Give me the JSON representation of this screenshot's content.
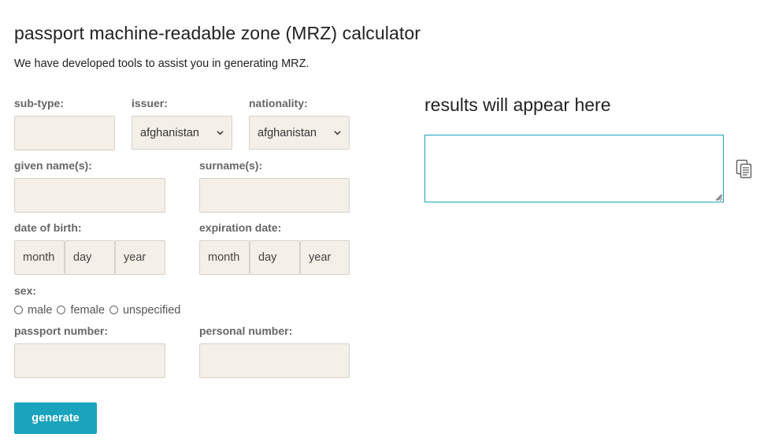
{
  "header": {
    "title": "passport machine-readable zone (MRZ) calculator",
    "subtitle": "We have developed tools to assist you in generating MRZ."
  },
  "form": {
    "subtype": {
      "label": "sub-type:",
      "value": ""
    },
    "issuer": {
      "label": "issuer:",
      "selected": "afghanistan"
    },
    "nationality": {
      "label": "nationality:",
      "selected": "afghanistan"
    },
    "given_names": {
      "label": "given name(s):",
      "value": ""
    },
    "surnames": {
      "label": "surname(s):",
      "value": ""
    },
    "dob": {
      "label": "date of birth:",
      "month_placeholder": "month",
      "day_placeholder": "day",
      "year_placeholder": "year"
    },
    "expiration": {
      "label": "expiration date:",
      "month_placeholder": "month",
      "day_placeholder": "day",
      "year_placeholder": "year"
    },
    "sex": {
      "label": "sex:",
      "options": [
        "male",
        "female",
        "unspecified"
      ]
    },
    "passport_number": {
      "label": "passport number:",
      "value": ""
    },
    "personal_number": {
      "label": "personal number:",
      "value": ""
    },
    "generate_label": "generate"
  },
  "results": {
    "title": "results will appear here",
    "value": ""
  },
  "icons": {
    "select_arrow": "chevron-down-icon",
    "copy": "copy-icon",
    "resize": "resize-grip-icon"
  },
  "colors": {
    "accent": "#1aa3bd",
    "field_bg": "#f4efe7",
    "label": "#666666"
  }
}
